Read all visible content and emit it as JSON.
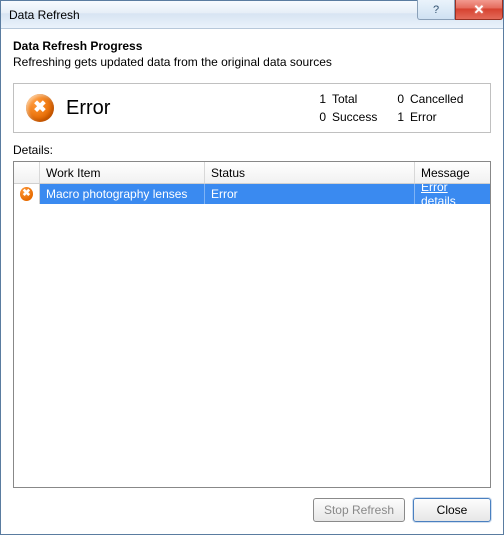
{
  "window": {
    "title": "Data Refresh"
  },
  "header": {
    "heading": "Data Refresh Progress",
    "subheading": "Refreshing gets updated data from the original data sources"
  },
  "status": {
    "icon": "error-icon",
    "label": "Error",
    "counts": {
      "total_num": "1",
      "total_label": "Total",
      "cancelled_num": "0",
      "cancelled_label": "Cancelled",
      "success_num": "0",
      "success_label": "Success",
      "error_num": "1",
      "error_label": "Error"
    }
  },
  "details": {
    "label": "Details:",
    "columns": {
      "work_item": "Work Item",
      "status": "Status",
      "message": "Message"
    },
    "rows": [
      {
        "icon": "error-icon",
        "work_item": "Macro photography lenses",
        "status": "Error",
        "message": "Error details"
      }
    ]
  },
  "footer": {
    "stop_refresh": "Stop Refresh",
    "close": "Close"
  }
}
